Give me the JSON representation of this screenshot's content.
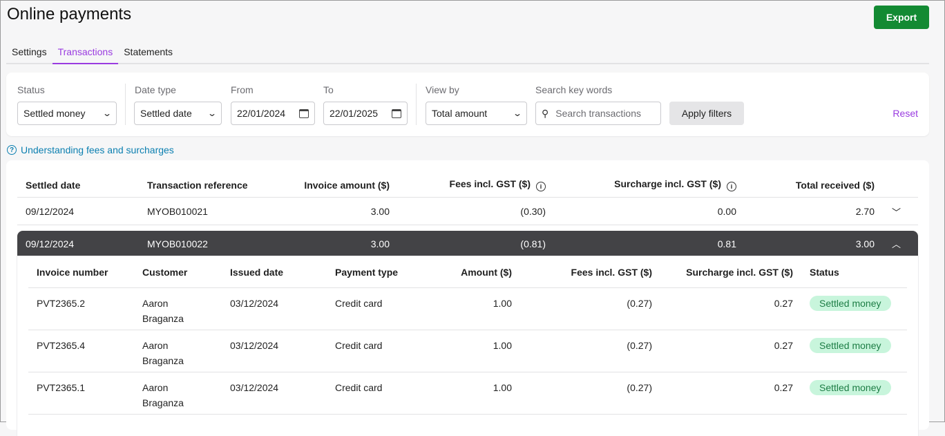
{
  "header": {
    "title": "Online payments",
    "export_label": "Export"
  },
  "tabs": [
    "Settings",
    "Transactions",
    "Statements"
  ],
  "filters": {
    "status_label": "Status",
    "status_value": "Settled money",
    "date_type_label": "Date type",
    "date_type_value": "Settled date",
    "from_label": "From",
    "from_value": "22/01/2024",
    "to_label": "To",
    "to_value": "22/01/2025",
    "view_by_label": "View by",
    "view_by_value": "Total amount",
    "search_label": "Search key words",
    "search_placeholder": "Search transactions",
    "apply_label": "Apply filters",
    "reset_label": "Reset"
  },
  "help_link": "Understanding fees and surcharges",
  "table": {
    "headers": [
      "Settled date",
      "Transaction reference",
      "Invoice amount ($)",
      "Fees incl. GST ($)",
      "Surcharge incl. GST ($)",
      "Total received ($)"
    ],
    "rows": [
      [
        "09/12/2024",
        "MYOB010021",
        "3.00",
        "(0.30)",
        "0.00",
        "2.70"
      ],
      [
        "09/12/2024",
        "MYOB010022",
        "3.00",
        "(0.81)",
        "0.81",
        "3.00"
      ]
    ]
  },
  "subtable": {
    "headers": [
      "Invoice number",
      "Customer",
      "Issued date",
      "Payment type",
      "Amount ($)",
      "Fees incl. GST ($)",
      "Surcharge incl. GST ($)",
      "Status"
    ],
    "rows": [
      [
        "PVT2365.2",
        "Aaron Braganza",
        "03/12/2024",
        "Credit card",
        "1.00",
        "(0.27)",
        "0.27",
        "Settled money"
      ],
      [
        "PVT2365.4",
        "Aaron Braganza",
        "03/12/2024",
        "Credit card",
        "1.00",
        "(0.27)",
        "0.27",
        "Settled money"
      ],
      [
        "PVT2365.1",
        "Aaron Braganza",
        "03/12/2024",
        "Credit card",
        "1.00",
        "(0.27)",
        "0.27",
        "Settled money"
      ]
    ]
  },
  "colors": {
    "accent": "#9a3be0",
    "primary": "#138a33",
    "link": "#0b7fb0",
    "badge_bg": "#c8f5dc"
  }
}
